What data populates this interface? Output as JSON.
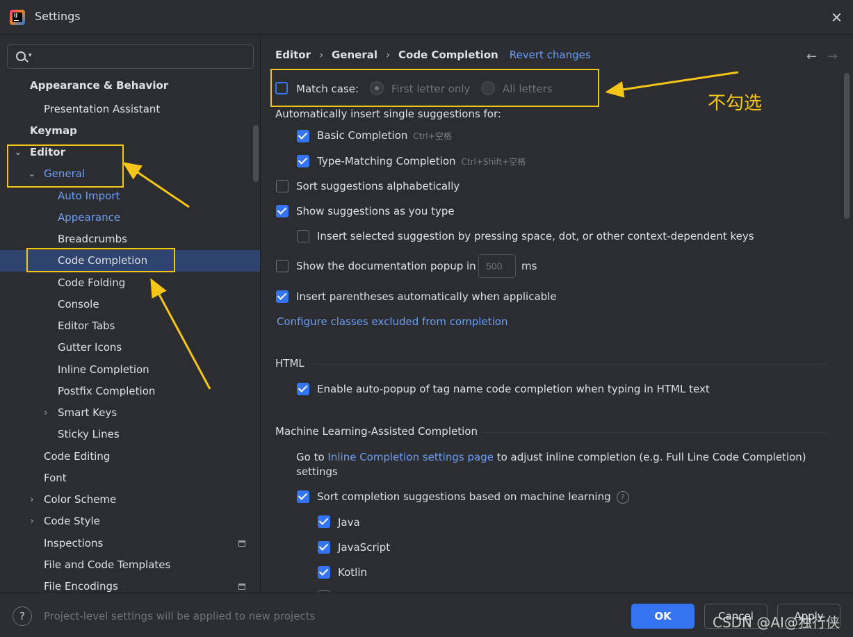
{
  "window": {
    "title": "Settings"
  },
  "sidebar": {
    "search_placeholder": "",
    "items": [
      {
        "label": "Appearance & Behavior",
        "bold": true
      },
      {
        "label": "Presentation Assistant"
      },
      {
        "label": "Keymap",
        "bold": true
      },
      {
        "label": "Editor",
        "bold": true,
        "expanded": true
      },
      {
        "label": "General",
        "expanded": true
      },
      {
        "label": "Auto Import"
      },
      {
        "label": "Appearance"
      },
      {
        "label": "Breadcrumbs"
      },
      {
        "label": "Code Completion",
        "selected": true
      },
      {
        "label": "Code Folding"
      },
      {
        "label": "Console"
      },
      {
        "label": "Editor Tabs"
      },
      {
        "label": "Gutter Icons"
      },
      {
        "label": "Inline Completion"
      },
      {
        "label": "Postfix Completion"
      },
      {
        "label": "Smart Keys",
        "collapsed": true
      },
      {
        "label": "Sticky Lines"
      },
      {
        "label": "Code Editing"
      },
      {
        "label": "Font"
      },
      {
        "label": "Color Scheme",
        "collapsed": true
      },
      {
        "label": "Code Style",
        "collapsed": true
      },
      {
        "label": "Inspections"
      },
      {
        "label": "File and Code Templates"
      },
      {
        "label": "File Encodings"
      }
    ]
  },
  "breadcrumb": {
    "items": [
      "Editor",
      "General",
      "Code Completion"
    ],
    "separator": "›",
    "revert_label": "Revert changes"
  },
  "nav": {
    "back": "←",
    "forward": "→"
  },
  "settings": {
    "match_case": {
      "label": "Match case:",
      "checked": false
    },
    "radio_first_letter": "First letter only",
    "radio_all_letters": "All letters",
    "auto_insert_heading": "Automatically insert single suggestions for:",
    "basic_completion": {
      "label": "Basic Completion",
      "shortcut": "Ctrl+空格",
      "checked": true
    },
    "type_matching": {
      "label": "Type-Matching Completion",
      "shortcut": "Ctrl+Shift+空格",
      "checked": true
    },
    "sort_alpha": {
      "label": "Sort suggestions alphabetically",
      "checked": false
    },
    "show_as_type": {
      "label": "Show suggestions as you type",
      "checked": true
    },
    "insert_selected": {
      "label": "Insert selected suggestion by pressing space, dot, or other context-dependent keys",
      "checked": false
    },
    "doc_popup": {
      "label": "Show the documentation popup in",
      "value": "500",
      "unit": "ms",
      "checked": false
    },
    "insert_parens": {
      "label": "Insert parentheses automatically when applicable",
      "checked": true
    },
    "configure_link": "Configure classes excluded from completion",
    "html_section": "HTML",
    "html_auto_popup": {
      "label": "Enable auto-popup of tag name code completion when typing in HTML text",
      "checked": true
    },
    "ml_section": "Machine Learning-Assisted Completion",
    "ml_goto_prefix": "Go to",
    "ml_goto_link": "Inline Completion settings page",
    "ml_goto_suffix": "to adjust inline completion (e.g. Full Line Code Completion)",
    "ml_goto_line2": "settings",
    "ml_sort": {
      "label": "Sort completion suggestions based on machine learning",
      "checked": true
    },
    "help_glyph": "?",
    "ml_java": {
      "label": "Java",
      "checked": true
    },
    "ml_javascript": {
      "label": "JavaScript",
      "checked": true
    },
    "ml_kotlin": {
      "label": "Kotlin",
      "checked": true
    }
  },
  "footer": {
    "help": "?",
    "note": "Project-level settings will be applied to new projects",
    "ok": "OK",
    "cancel": "Cancel",
    "apply": "Apply"
  },
  "annotation": {
    "text": "不勾选",
    "color": "#f5c518"
  },
  "watermark": "CSDN @AI@独行侠",
  "colors": {
    "accent": "#3574f0",
    "link": "#6e9ef5",
    "selection": "#2e436e",
    "background": "#2b2d30"
  }
}
